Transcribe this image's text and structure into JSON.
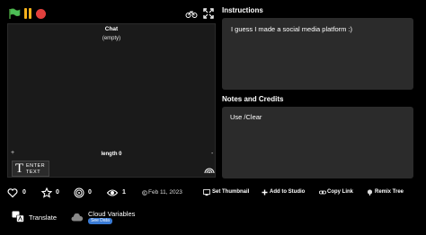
{
  "stage": {
    "chat_title": "Chat",
    "chat_empty": "(empty)",
    "length_label": "length 0",
    "plus": "+",
    "minus": "-",
    "enter_t": "T",
    "enter_line1": "ENTER",
    "enter_line2": "TEXT"
  },
  "instructions": {
    "heading": "Instructions",
    "text": "I guess I made a social media platform :)"
  },
  "notes": {
    "heading": "Notes and Credits",
    "text": "Use /Clear"
  },
  "stats": {
    "loves": "0",
    "favorites": "0",
    "remixes": "0",
    "views": "1",
    "date": "Feb 11, 2023"
  },
  "actions": {
    "see_thumbnail": "Set Thumbnail",
    "add_to_studio": "Add to Studio",
    "copy_link": "Copy Link",
    "remix_tree": "Remix Tree"
  },
  "bottom": {
    "translate": "Translate",
    "cloud_variables": "Cloud Variables",
    "see_data": "See Data"
  },
  "colors": {
    "background": "#000000",
    "panel": "#2b2b2b",
    "accent": "#3a7bd5",
    "stop": "#e2403d",
    "pause": "#f7b21b",
    "flag": "#4cbf56"
  }
}
